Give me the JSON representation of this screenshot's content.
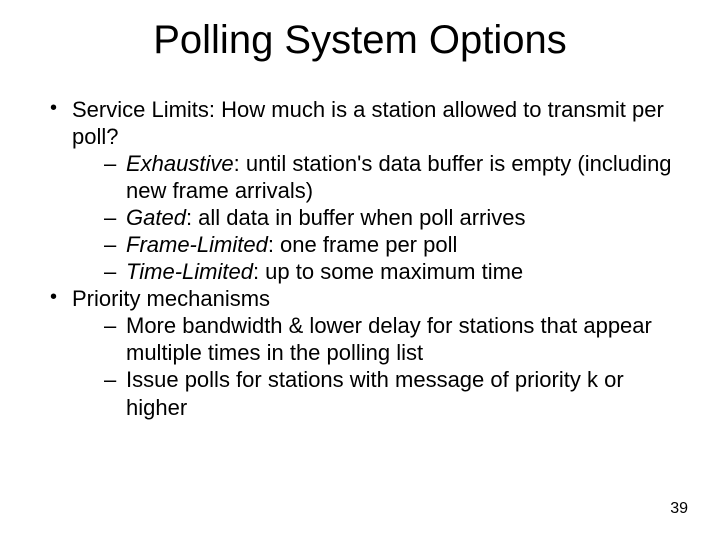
{
  "title": "Polling System Options",
  "bullets": {
    "b0": {
      "text": "Service Limits:  How much is a station allowed to transmit per poll?",
      "sub": {
        "s0_term": "Exhaustive",
        "s0_rest": ":  until station's data buffer is empty (including new frame arrivals)",
        "s1_term": "Gated",
        "s1_rest": ":  all data in buffer when poll arrives",
        "s2_term": "Frame-Limited",
        "s2_rest": ":  one frame per poll",
        "s3_term": "Time-Limited",
        "s3_rest": ":  up to some maximum time"
      }
    },
    "b1": {
      "text": "Priority mechanisms",
      "sub": {
        "s0": "More bandwidth & lower delay for stations that appear multiple times in the polling list",
        "s1": "Issue polls for stations with message of priority k or higher"
      }
    }
  },
  "page_number": "39"
}
